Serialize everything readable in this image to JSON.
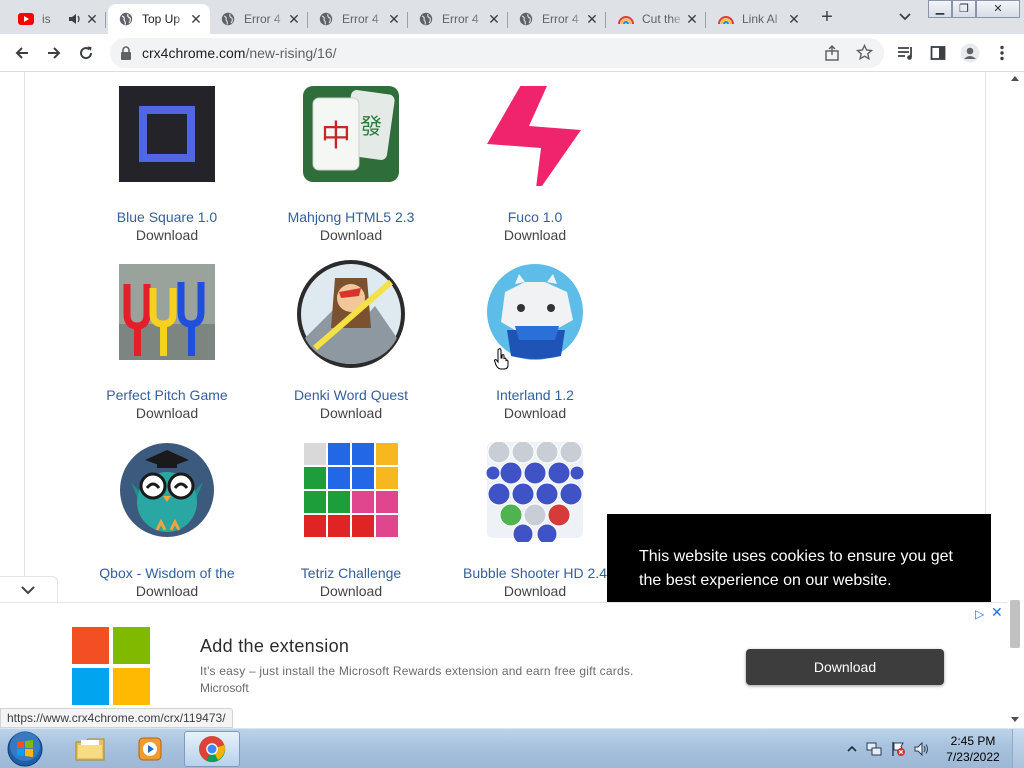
{
  "browser": {
    "tabs": [
      {
        "title": "is",
        "favicon": "youtube-icon",
        "extra_icon": "audio-icon"
      },
      {
        "title": "Top Up",
        "favicon": "globe-icon",
        "active": true
      },
      {
        "title": "Error 4",
        "favicon": "globe-icon"
      },
      {
        "title": "Error 4",
        "favicon": "globe-icon"
      },
      {
        "title": "Error 4",
        "favicon": "globe-icon"
      },
      {
        "title": "Error 4",
        "favicon": "globe-icon"
      },
      {
        "title": "Cut the",
        "favicon": "rainbow-icon"
      },
      {
        "title": "Link Al",
        "favicon": "rainbow-icon"
      }
    ],
    "new_tab_label": "+",
    "address": {
      "domain": "crx4chrome.com",
      "path": "/new-rising/16/"
    }
  },
  "extensions": [
    {
      "name": "Blue Square 1.0",
      "download": "Download",
      "icon": "blue-square-icon"
    },
    {
      "name": "Mahjong HTML5 2.3",
      "download": "Download",
      "icon": "mahjong-icon"
    },
    {
      "name": "Fuco 1.0",
      "download": "Download",
      "icon": "lightning-icon"
    },
    {
      "name": "Perfect Pitch Game",
      "download": "Download",
      "icon": "tuning-fork-icon"
    },
    {
      "name": "Denki Word Quest",
      "download": "Download",
      "icon": "denki-icon"
    },
    {
      "name": "Interland 1.2",
      "download": "Download",
      "icon": "interland-icon"
    },
    {
      "name": "Qbox - Wisdom of the",
      "download": "Download",
      "icon": "owl-icon"
    },
    {
      "name": "Tetriz Challenge",
      "download": "Download",
      "icon": "tetris-icon"
    },
    {
      "name": "Bubble Shooter HD 2.4",
      "download": "Download",
      "icon": "bubbles-icon"
    }
  ],
  "cookie_banner": {
    "text": "This website uses cookies to ensure you get the best experience on our website."
  },
  "ad": {
    "title": "Add the extension",
    "text": "It's easy – just install the Microsoft Rewards extension and earn free gift cards.",
    "brand": "Microsoft",
    "button": "Download",
    "close": "✕"
  },
  "status_url": "https://www.crx4chrome.com/crx/119473/",
  "taskbar": {
    "time": "2:45 PM",
    "date": "7/23/2022"
  },
  "colors": {
    "link": "#35609e",
    "cookie_bg": "#000000",
    "ad_button": "#3d3d3d",
    "fuco": "#f0246c"
  }
}
